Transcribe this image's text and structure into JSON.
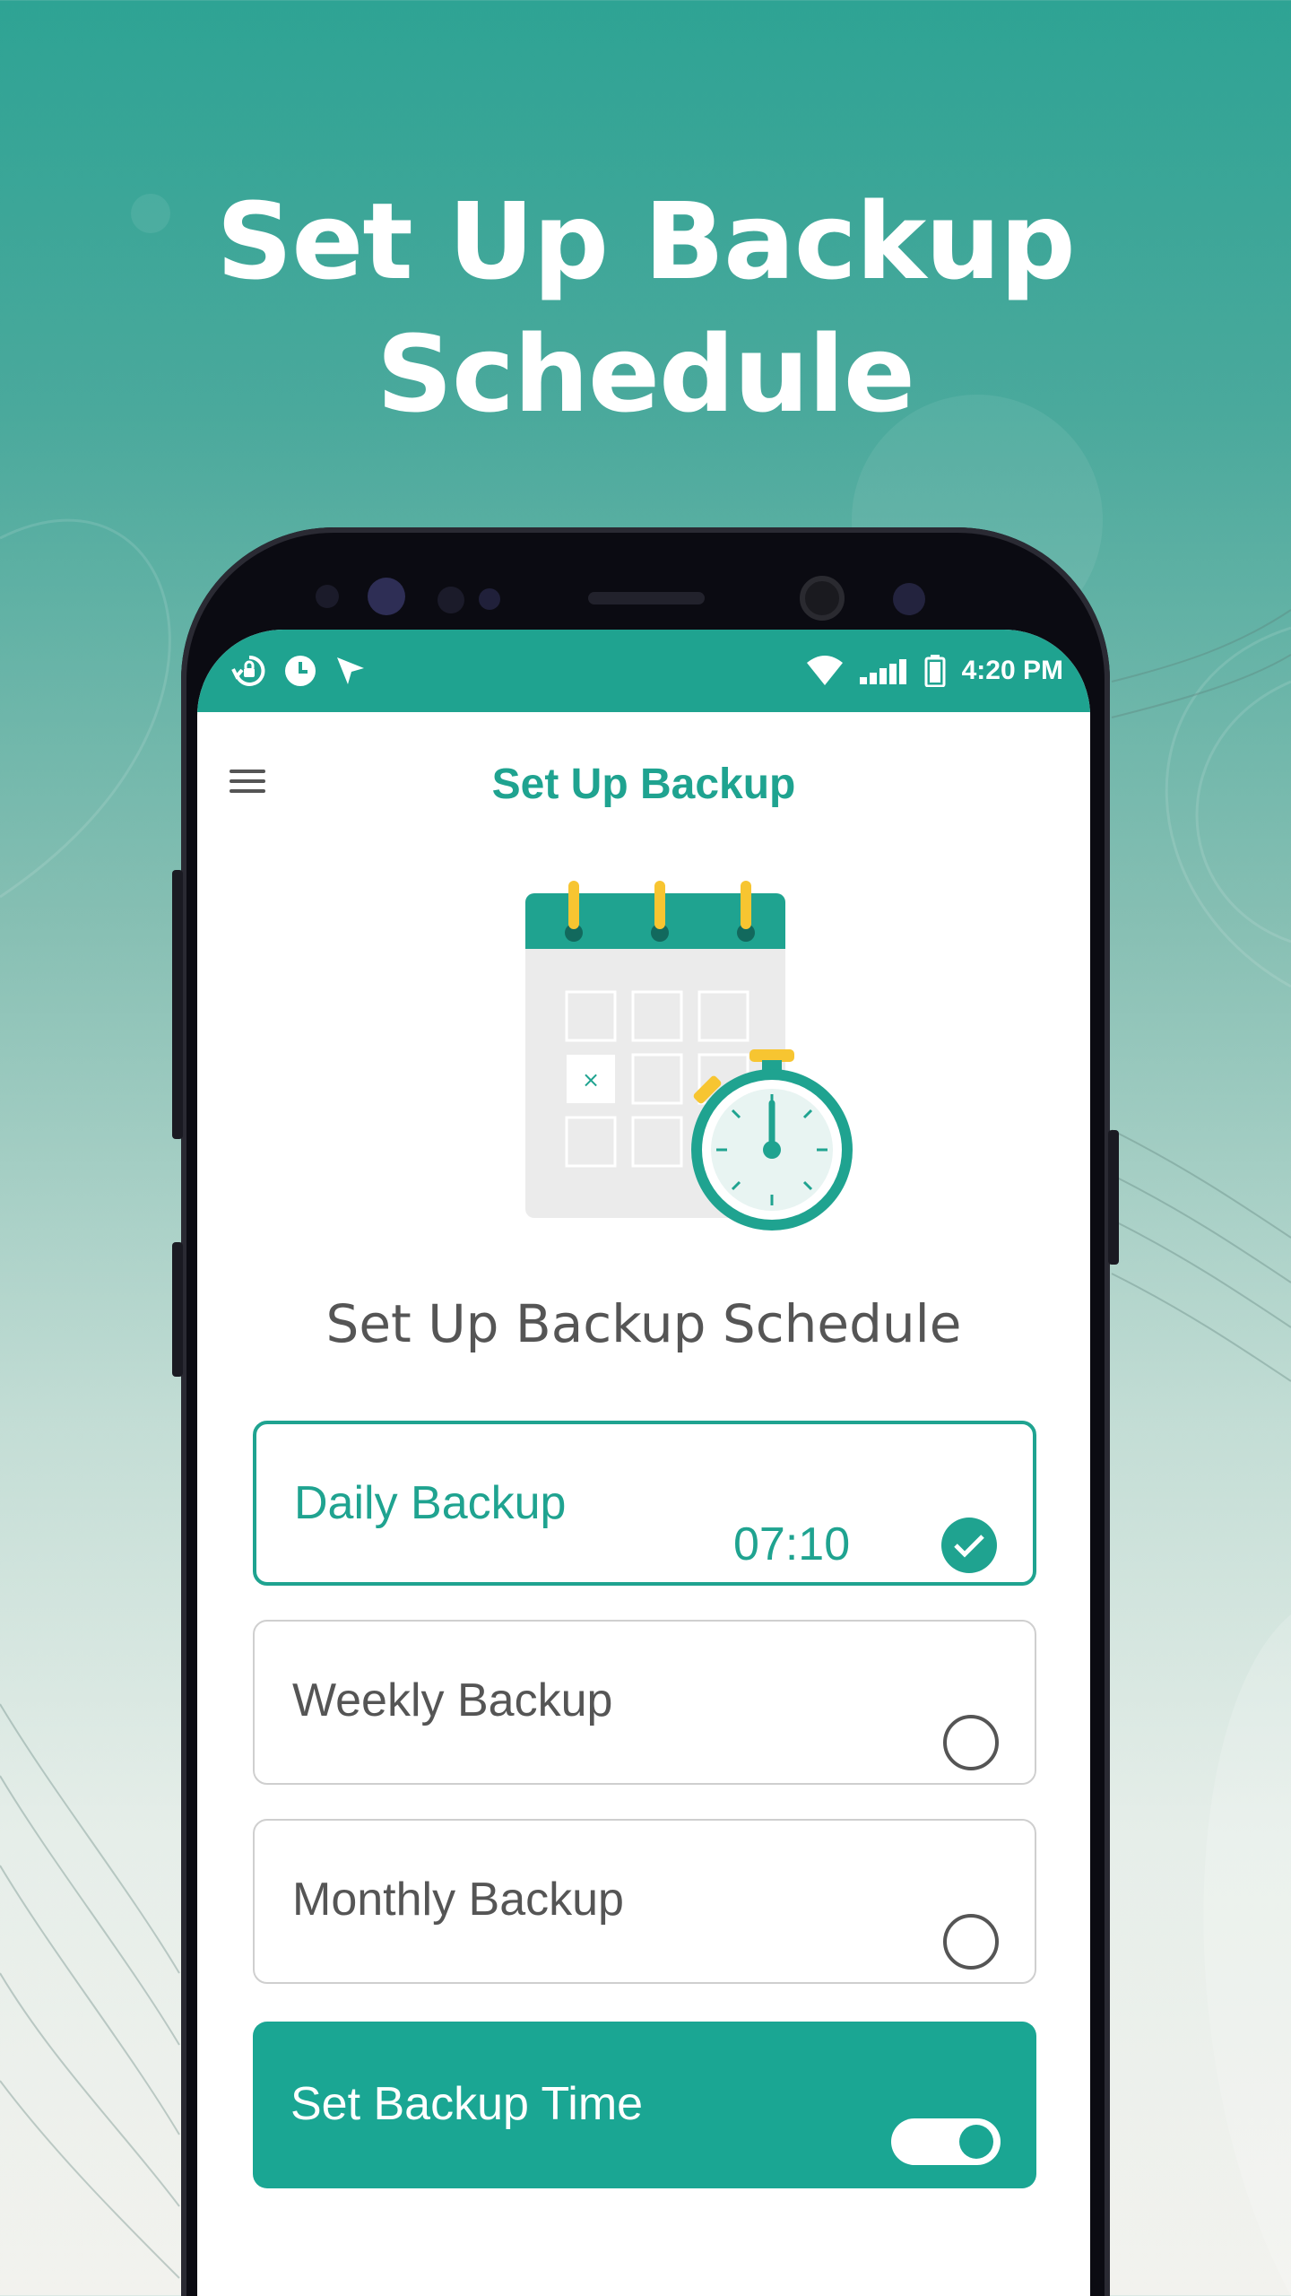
{
  "headline": {
    "line1": "Set Up Backup",
    "line2": "Schedule"
  },
  "status_bar": {
    "time": "4:20 PM",
    "left_icons": [
      "backup-restore-icon",
      "clock-icon",
      "location-arrow-icon"
    ],
    "right_icons": [
      "wifi-icon",
      "signal-icon",
      "battery-icon"
    ]
  },
  "app_bar": {
    "title": "Set Up Backup",
    "menu_icon": "hamburger-menu-icon"
  },
  "illustration": {
    "name": "calendar-stopwatch-illustration",
    "calendar_mark": "×"
  },
  "section_title": "Set Up Backup Schedule",
  "options": [
    {
      "label": "Daily Backup",
      "time": "07:10",
      "selected": true
    },
    {
      "label": "Weekly Backup",
      "selected": false
    },
    {
      "label": "Monthly Backup",
      "selected": false
    }
  ],
  "backup_time": {
    "label": "Set Backup Time",
    "toggle_on": true
  },
  "colors": {
    "accent": "#1fa390",
    "text": "#555555",
    "highlight": "#f7c531"
  }
}
